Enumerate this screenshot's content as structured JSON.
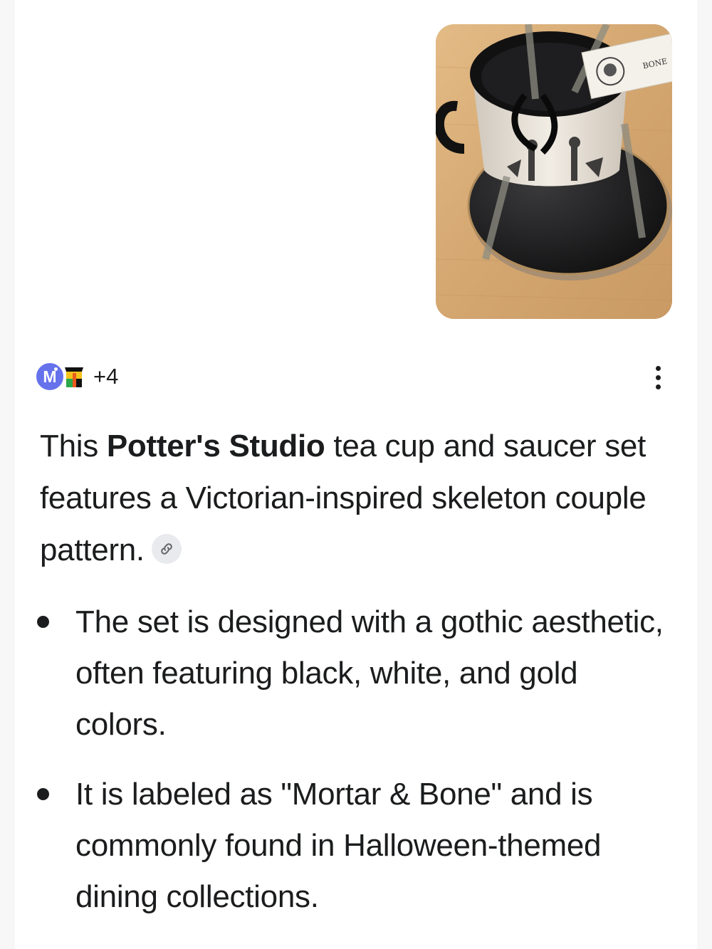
{
  "image": {
    "alt_icon": "teacup-photo",
    "tag_text": "BONE"
  },
  "sources": {
    "avatar_letter": "M",
    "more_count": "+4"
  },
  "answer": {
    "intro_before": "This ",
    "brand": "Potter's Studio",
    "intro_after": " tea cup and saucer set features a Victorian-inspired skeleton couple pattern."
  },
  "bullets": [
    "The set is designed with a gothic aesthetic, often featuring black, white, and gold colors.",
    "It is labeled as \"Mortar & Bone\" and is commonly found in Halloween-themed dining collections."
  ],
  "colors": {
    "avatar_accent": "#6671ec",
    "status_green": "#2db35a",
    "chip_background": "#e9eaee"
  }
}
